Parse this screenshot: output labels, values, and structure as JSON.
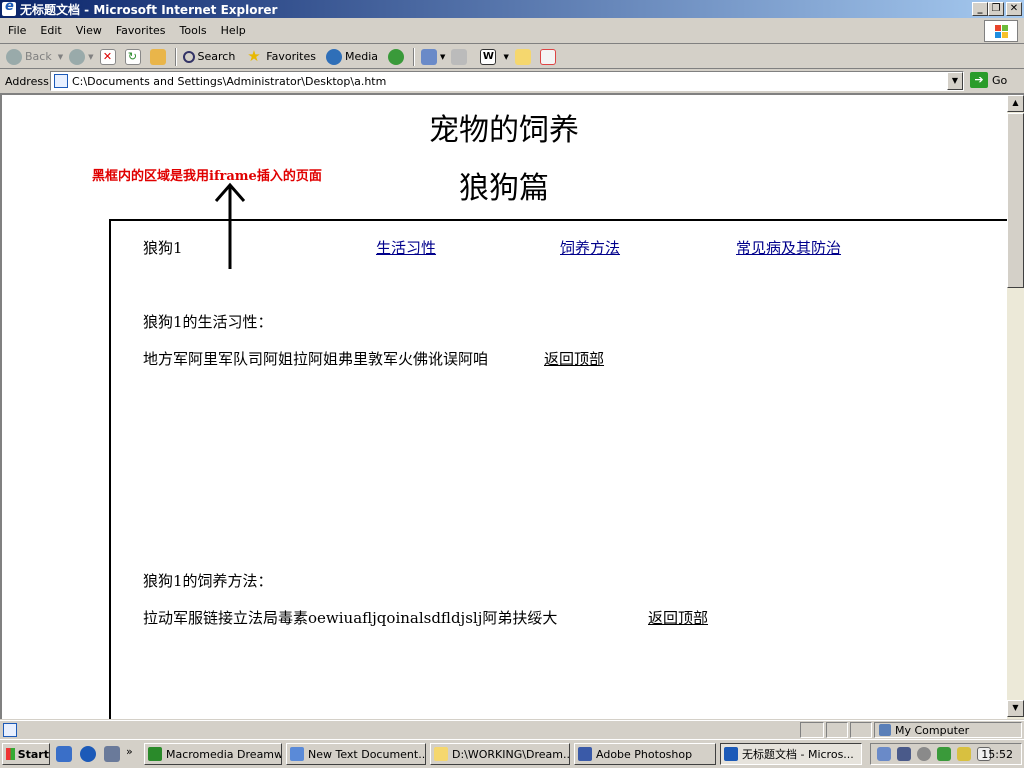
{
  "window": {
    "title": "无标题文档 - Microsoft Internet Explorer",
    "buttons": [
      "_",
      "❐",
      "✕"
    ]
  },
  "menu": [
    "File",
    "Edit",
    "View",
    "Favorites",
    "Tools",
    "Help"
  ],
  "toolbar": {
    "back": "Back",
    "search": "Search",
    "favorites": "Favorites",
    "media": "Media"
  },
  "address": {
    "label": "Address",
    "value": "C:\\Documents and Settings\\Administrator\\Desktop\\a.htm",
    "go": "Go"
  },
  "page": {
    "title": "宠物的饲养",
    "subtitle": "狼狗篇",
    "annotation": "黑框内的区域是我用iframe插入的页面"
  },
  "iframe": {
    "nav": {
      "current": "狼狗1",
      "links": [
        "生活习性",
        "饲养方法",
        "常见病及其防治"
      ]
    },
    "sections": [
      {
        "heading": "狼狗1的生活习性：",
        "text": "地方军阿里军队司阿姐拉阿姐弗里敦军火佛讹误阿咱",
        "back": "返回顶部"
      },
      {
        "heading": "狼狗1的饲养方法：",
        "text": "拉动军服链接立法局毒素oewiuafljqoinalsdfldjslj阿弟扶绥大",
        "back": "返回顶部"
      }
    ]
  },
  "statusbar": {
    "zone": "My Computer"
  },
  "taskbar": {
    "start": "Start",
    "tasks": [
      "Macromedia Dreamw...",
      "New Text Document....",
      "D:\\WORKING\\Dream...",
      "Adobe Photoshop",
      "无标题文档 - Micros..."
    ],
    "clock": "15:52"
  },
  "colors": {
    "annotation": "#e00000",
    "link": "#00008b",
    "visited_link": "#6b0d7a",
    "titlebar_start": "#0a246a",
    "titlebar_end": "#a6caf0"
  },
  "icons": [
    "ie-icon",
    "back-icon",
    "forward-icon",
    "stop-icon",
    "refresh-icon",
    "home-icon",
    "search-icon",
    "favorites-icon",
    "media-icon",
    "history-icon",
    "mail-icon",
    "print-icon",
    "word-icon",
    "folder-icon",
    "messenger-icon",
    "go-icon",
    "windows-logo-icon"
  ]
}
